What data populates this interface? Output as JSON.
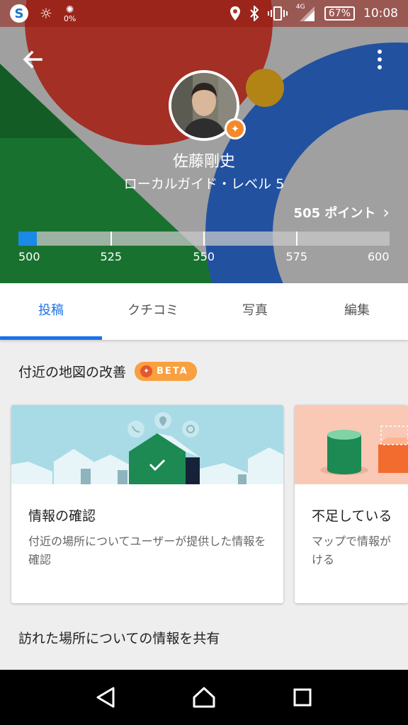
{
  "status_bar": {
    "app_icon_letter": "S",
    "data_saver_label": "0%",
    "network_type": "4G",
    "battery": "67%",
    "time": "10:08",
    "icons": [
      "brightness-icon",
      "location-icon",
      "bluetooth-icon",
      "vibrate-icon",
      "signal-icon",
      "battery-icon"
    ]
  },
  "header": {
    "back_icon": "arrow-back-icon",
    "more_icon": "more-vert-icon",
    "name": "佐藤剛史",
    "level": "ローカルガイド・レベル 5",
    "points_link": "505 ポイント",
    "progress": {
      "current": 505,
      "min": 500,
      "max": 600,
      "ticks": [
        "500",
        "525",
        "550",
        "575",
        "600"
      ]
    },
    "colors": {
      "red": "#c73a2e",
      "green": "#1f8a3b",
      "blue": "#2a63c4",
      "yellow": "#d9a21b",
      "progress_fill": "#1a8ae6"
    }
  },
  "tabs": [
    {
      "label": "投稿",
      "active": true
    },
    {
      "label": "クチコミ",
      "active": false
    },
    {
      "label": "写真",
      "active": false
    },
    {
      "label": "編集",
      "active": false
    }
  ],
  "nearby_section": {
    "title": "付近の地図の改善",
    "badge": "BETA",
    "cards": [
      {
        "title": "情報の確認",
        "description": "付近の場所についてユーザーが提供した情報を確認"
      },
      {
        "title": "不足している",
        "description": "マップで情報が\nける"
      }
    ]
  },
  "share_section": {
    "title": "訪れた場所についての情報を共有"
  },
  "navigation_bar": {
    "buttons": [
      "back-triangle-icon",
      "home-circle-icon",
      "recents-square-icon"
    ]
  }
}
